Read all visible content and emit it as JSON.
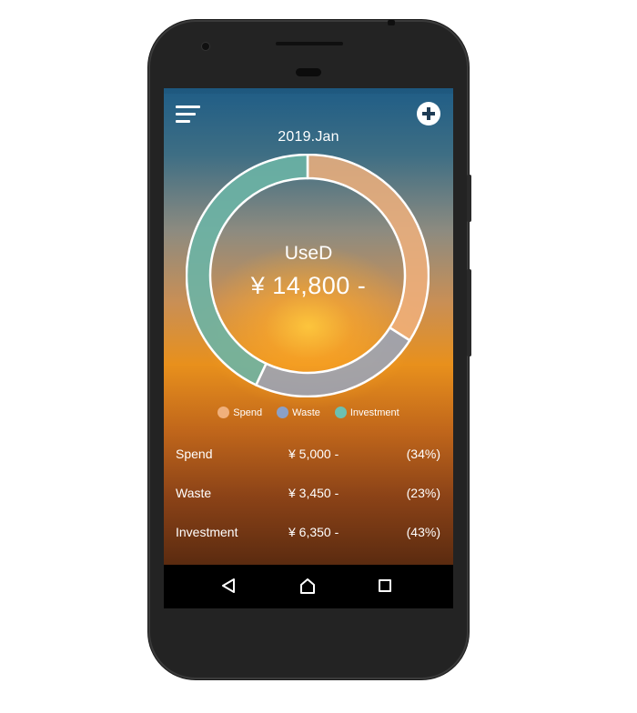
{
  "header": {
    "month": "2019.Jan",
    "menu_icon": "hamburger-menu-icon",
    "add_icon": "plus-circle-icon"
  },
  "summary": {
    "label": "UseD",
    "amount": "¥ 14,800 -"
  },
  "chart_data": {
    "type": "pie",
    "style": "donut",
    "categories": [
      "Spend",
      "Waste",
      "Investment"
    ],
    "values": [
      34,
      23,
      43
    ],
    "colors": [
      "#f0b07c",
      "#8aa0c8",
      "#6cc0b0"
    ]
  },
  "legend": [
    {
      "label": "Spend",
      "color": "#f0b07c"
    },
    {
      "label": "Waste",
      "color": "#8aa0c8"
    },
    {
      "label": "Investment",
      "color": "#6cc0b0"
    }
  ],
  "rows": [
    {
      "name": "Spend",
      "amount": "¥ 5,000 -",
      "pct": "(34%)"
    },
    {
      "name": "Waste",
      "amount": "¥ 3,450 -",
      "pct": "(23%)"
    },
    {
      "name": "Investment",
      "amount": "¥ 6,350 -",
      "pct": "(43%)"
    }
  ],
  "navbar": {
    "back_icon": "back-triangle-icon",
    "home_icon": "home-icon",
    "recent_icon": "recent-apps-icon"
  }
}
